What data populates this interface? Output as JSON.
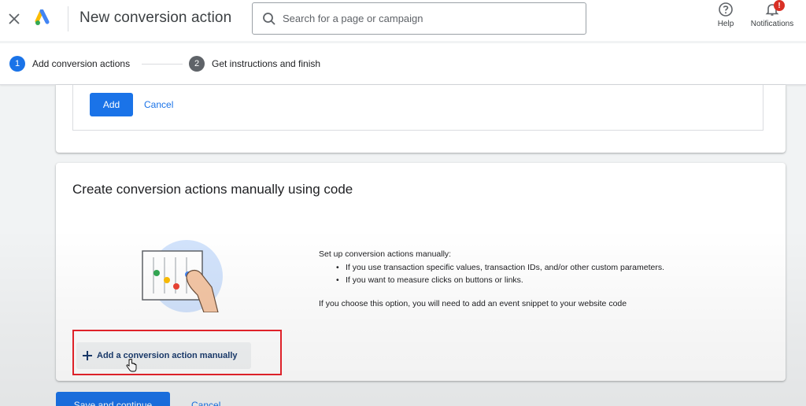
{
  "header": {
    "title": "New conversion action",
    "search_placeholder": "Search for a page or campaign",
    "help_label": "Help",
    "notifications_label": "Notifications",
    "notifications_badge": "!"
  },
  "stepper": {
    "steps": [
      {
        "number": "1",
        "label": "Add conversion actions",
        "active": true
      },
      {
        "number": "2",
        "label": "Get instructions and finish",
        "active": false
      }
    ]
  },
  "top_card": {
    "add_label": "Add",
    "cancel_label": "Cancel"
  },
  "manual_card": {
    "title": "Create conversion actions manually using code",
    "intro": "Set up conversion actions manually:",
    "bullets": [
      "If you use transaction specific values, transaction IDs, and/or other custom parameters.",
      "If you want to measure clicks on buttons or links."
    ],
    "note": "If you choose this option, you will need to add an event snippet to your website code",
    "add_manual_label": "Add a conversion action manually"
  },
  "footer": {
    "save_label": "Save and continue",
    "cancel_label": "Cancel"
  },
  "colors": {
    "primary": "#1a73e8",
    "highlight": "#e8232b",
    "badge": "#d93025"
  }
}
